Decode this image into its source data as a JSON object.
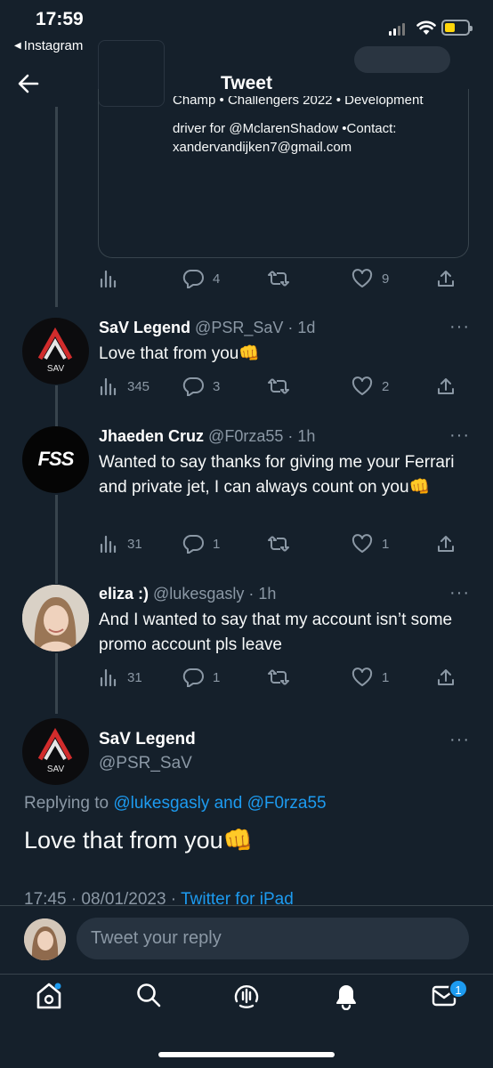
{
  "status_bar": {
    "time": "17:59",
    "back_app": "Instagram",
    "battery_color": "#ffd60a"
  },
  "header": {
    "title": "Tweet"
  },
  "quoted": {
    "bio_line1": "Champ • Challengers 2022 • Development",
    "bio_line2": "driver for @MclarenShadow •Contact:",
    "bio_line3": "xandervandijken7@gmail.com",
    "replies": "4",
    "likes": "9"
  },
  "tweets": [
    {
      "name": "SaV Legend",
      "meta": "@PSR_SaV · 1d",
      "text": "Love that from you👊",
      "views": "345",
      "replies": "3",
      "retweets": "",
      "likes": "2"
    },
    {
      "name": "Jhaeden Cruz",
      "meta": "@F0rza55 · 1h",
      "text": "Wanted to say thanks for giving me your Ferrari and private jet, I can always count on you👊",
      "views": "31",
      "replies": "1",
      "retweets": "",
      "likes": "1"
    },
    {
      "name": "eliza :)",
      "meta": "@lukesgasly · 1h",
      "text": "And I wanted to say that my account isn’t some promo account pls leave",
      "views": "31",
      "replies": "1",
      "retweets": "",
      "likes": "1"
    }
  ],
  "main_tweet": {
    "name": "SaV Legend",
    "handle": "@PSR_SaV",
    "replying_prefix": "Replying to",
    "replying_users": "@lukesgasly and @F0rza55",
    "text": "Love that from you👊",
    "timestamp": "17:45 · 08/01/2023 · ",
    "client": "Twitter for iPad"
  },
  "reply_box": {
    "placeholder": "Tweet your reply"
  },
  "tabbar": {
    "messages_badge": "1"
  },
  "colors": {
    "background": "#15202b",
    "accent": "#1d9bf0",
    "muted": "#8b98a5"
  },
  "icons": [
    "back-arrow-icon",
    "views-icon",
    "reply-icon",
    "retweet-icon",
    "like-icon",
    "share-icon",
    "more-icon",
    "home-icon",
    "search-icon",
    "spaces-icon",
    "notifications-icon",
    "messages-icon"
  ]
}
